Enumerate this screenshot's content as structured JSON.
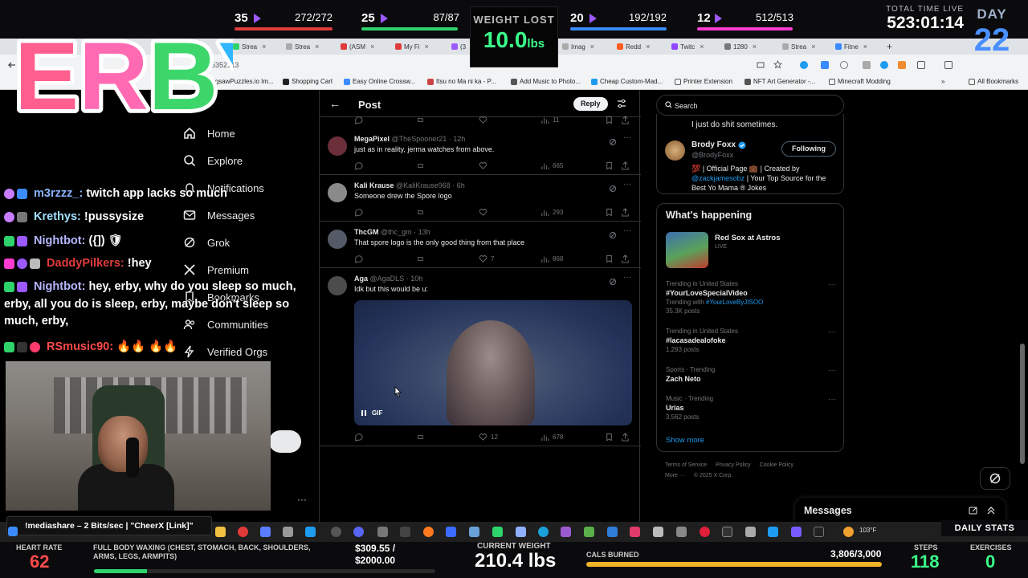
{
  "overlay": {
    "stat_groups": [
      {
        "level": "35",
        "value": "272/272",
        "bar_color": "#e03b3b"
      },
      {
        "level": "25",
        "value": "87/87",
        "bar_color": "#2fd36b"
      },
      {
        "level": "20",
        "value": "192/192",
        "bar_color": "#3b8bff"
      },
      {
        "level": "12",
        "value": "512/513",
        "bar_color": "#ff3bd0"
      }
    ],
    "weight_lost_label": "WEIGHT LOST",
    "weight_lost_value": "10.0",
    "weight_lost_unit": "lbs",
    "total_time_label": "TOTAL TIME LIVE",
    "total_time_value": "523:01:14",
    "day_label": "DAY",
    "day_value": "22",
    "logo_text": "ERBY"
  },
  "browser": {
    "tabs": [
      "Strea",
      "Strea",
      "(ASM",
      "My Fi",
      "(3",
      "Imag",
      "Redd",
      "Twitc",
      "1280",
      "Strea",
      "Fitne"
    ],
    "url_fragment": "35352113",
    "bookmarks": [
      "JigsawPuzzles.io Im...",
      "Shopping Cart",
      "Easy Online Crossw...",
      "Itsu no Ma ni ka - P...",
      "Add Music to Photo...",
      "Cheap Custom-Mad...",
      "Printer Extension",
      "NFT Art Generator -...",
      "Minecraft Modding",
      "All Bookmarks"
    ]
  },
  "nav": {
    "items": [
      "Home",
      "Explore",
      "Notifications",
      "Messages",
      "Grok",
      "Premium",
      "Bookmarks",
      "Communities",
      "Verified Orgs"
    ]
  },
  "post": {
    "header_title": "Post",
    "reply_label": "Reply",
    "top_partial_stat": "11",
    "tweets": [
      {
        "name": "MegaPixel",
        "handle": "@TheSpooner21",
        "time": "12h",
        "text": "just as in reality, jerma watches from above.",
        "likes": "",
        "views": "665",
        "avatar_color": "#6b2f3a"
      },
      {
        "name": "Kali Krause",
        "handle": "@KaliKrause968",
        "time": "6h",
        "text": "Someone drew the Spore logo",
        "likes": "",
        "views": "293",
        "avatar_color": "#8a8a8a"
      },
      {
        "name": "ThcGM",
        "handle": "@thc_gm",
        "time": "13h",
        "text": "That spore logo is the only good thing from that place",
        "likes": "7",
        "views": "868",
        "avatar_color": "#555b66"
      },
      {
        "name": "Aga",
        "handle": "@AgaDLS",
        "time": "10h",
        "text": "Idk but this would be u:",
        "likes": "12",
        "views": "678",
        "avatar_color": "#4c4c4c"
      }
    ],
    "gif_label": "GIF"
  },
  "sidebar": {
    "search_placeholder": "Search",
    "profile": {
      "bio_top": "I just do shit sometimes.",
      "name": "Brody Foxx",
      "handle": "@BrodyFoxx",
      "follow_label": "Following",
      "bio_prefix": "💯 | Official Page 💼 | Created by",
      "bio_mention": "@zackjamesobz",
      "bio_suffix": "| Your Top Source for the Best Yo Mama ® Jokes"
    },
    "happening_title": "What's happening",
    "live_event": {
      "title": "Red Sox at Astros",
      "tag": "LIVE"
    },
    "trends": [
      {
        "context": "Trending in United States",
        "name": "#YourLoveSpecialVideo",
        "sub_prefix": "Trending with",
        "sub_hashtag": "#YourLoveByJISOO",
        "posts": "35.3K posts"
      },
      {
        "context": "Trending in United States",
        "name": "#lacasadealofoke",
        "sub_prefix": "",
        "sub_hashtag": "",
        "posts": "1,293 posts"
      },
      {
        "context": "Sports · Trending",
        "name": "Zach Neto",
        "sub_prefix": "",
        "sub_hashtag": "",
        "posts": ""
      },
      {
        "context": "Music · Trending",
        "name": "Urias",
        "sub_prefix": "",
        "sub_hashtag": "",
        "posts": "3,562 posts"
      }
    ],
    "show_more": "Show more",
    "footer": [
      "Terms of Service",
      "Privacy Policy",
      "Cookie Policy",
      "More ···",
      "© 2025 X Corp."
    ]
  },
  "messages_dock_label": "Messages",
  "chat": [
    {
      "user": "m3rzzz_:",
      "message": "twitch app lacks so much",
      "color": "#8ab4ff"
    },
    {
      "user": "Krethys:",
      "message": "!pussysize",
      "color": "#9fe0ff"
    },
    {
      "user": "Nightbot:",
      "message": "({]) 🛡",
      "color": "#b7b7ff"
    },
    {
      "user": "DaddyPilkers:",
      "message": "!hey",
      "color": "#e03b3b"
    },
    {
      "user": "Nightbot:",
      "message": "hey, erby, why do you sleep so much,",
      "color": "#b7b7ff"
    },
    {
      "user": "",
      "message": "erby, all you do is sleep, erby, maybe don't sleep so",
      "color": "#ffffff"
    },
    {
      "user": "",
      "message": "much, erby,",
      "color": "#ffffff"
    },
    {
      "user": "RSmusic90:",
      "message": "🔥🔥 🔥🔥",
      "color": "#ff4a4a"
    }
  ],
  "ticker": "!mediashare – 2 Bits/sec | \"CheerX [Link]\"",
  "taskbar": {
    "temperature": "103°F",
    "daily_stats_label": "DAILY STATS"
  },
  "bottom": {
    "heart_rate_label": "HEART RATE",
    "heart_rate_value": "62",
    "goal_label": "FULL BODY WAXING (CHEST, STOMACH, BACK, SHOULDERS, ARMS, LEGS, ARMPITS)",
    "goal_amount": "$309.55 /",
    "goal_total": "$2000.00",
    "goal_progress": 0.155,
    "current_weight_label": "CURRENT WEIGHT",
    "current_weight_value": "210.4 lbs",
    "cals_label": "CALS BURNED",
    "cals_value": "3,806/3,000",
    "cals_progress": 1.0,
    "steps_label": "STEPS",
    "steps_value": "118",
    "exercises_label": "EXERCISES",
    "exercises_value": "0"
  }
}
